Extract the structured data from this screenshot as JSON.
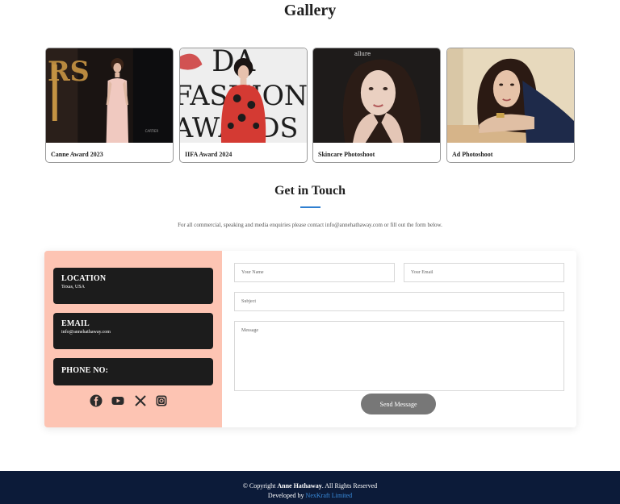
{
  "gallery": {
    "title": "Gallery",
    "items": [
      {
        "label": "Canne Award 2023"
      },
      {
        "label": "IIFA Award 2024"
      },
      {
        "label": "Skincare Photoshoot"
      },
      {
        "label": "Ad Photoshoot"
      }
    ],
    "watermark_allure": "allure",
    "fashion_letters": [
      "DA",
      "FASHION",
      "AWARDS"
    ]
  },
  "contact": {
    "title": "Get in Touch",
    "intro": "For all commercial, speaking and media enquiries please contact info@annehathaway.com or fill out the form below.",
    "location_heading": "LOCATION",
    "location_value": "Texas, USA",
    "email_heading": "EMAIL",
    "email_value": "info@annehathaway.com",
    "phone_heading": "PHONE NO:",
    "socials": [
      "facebook-icon",
      "youtube-icon",
      "x-icon",
      "instagram-icon"
    ],
    "form": {
      "name_placeholder": "Your Name",
      "email_placeholder": "Your Email",
      "subject_placeholder": "Subject",
      "message_placeholder": "Message",
      "send_label": "Send Message"
    }
  },
  "footer": {
    "copyright_prefix": "© Copyright ",
    "owner": "Anne Hathaway",
    "copyright_suffix": ". All Rights Reserved",
    "developed_prefix": "Developed by ",
    "developer": "NexKraft Limited"
  },
  "colors": {
    "accent_blue": "#2f7fd0",
    "info_panel_bg": "#fdc4b3",
    "info_box_bg": "#1c1c1c",
    "footer_bg": "#0c1b39",
    "footer_link": "#3a8dde",
    "send_button": "#777777"
  }
}
